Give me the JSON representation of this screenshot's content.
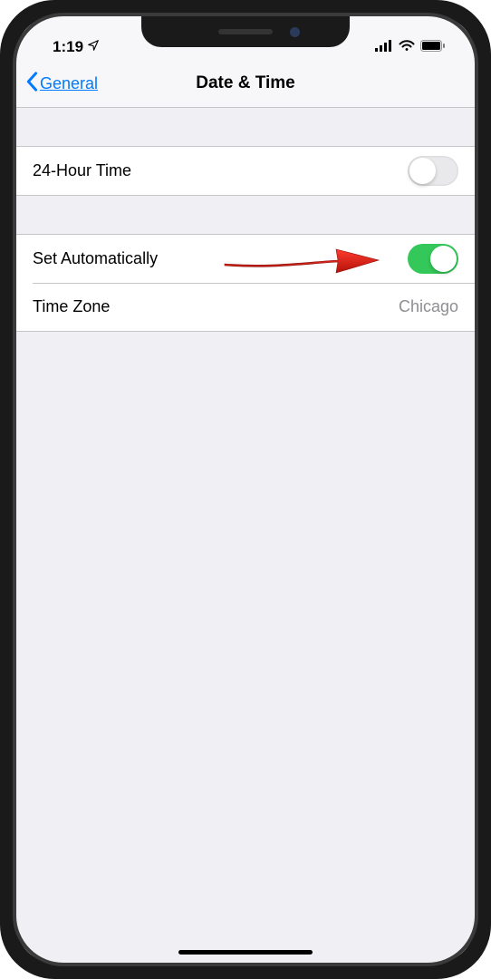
{
  "status": {
    "time": "1:19"
  },
  "nav": {
    "back_label": "General",
    "title": "Date & Time"
  },
  "rows": {
    "twenty_four_hour": {
      "label": "24-Hour Time",
      "on": false
    },
    "set_auto": {
      "label": "Set Automatically",
      "on": true
    },
    "time_zone": {
      "label": "Time Zone",
      "value": "Chicago"
    }
  }
}
